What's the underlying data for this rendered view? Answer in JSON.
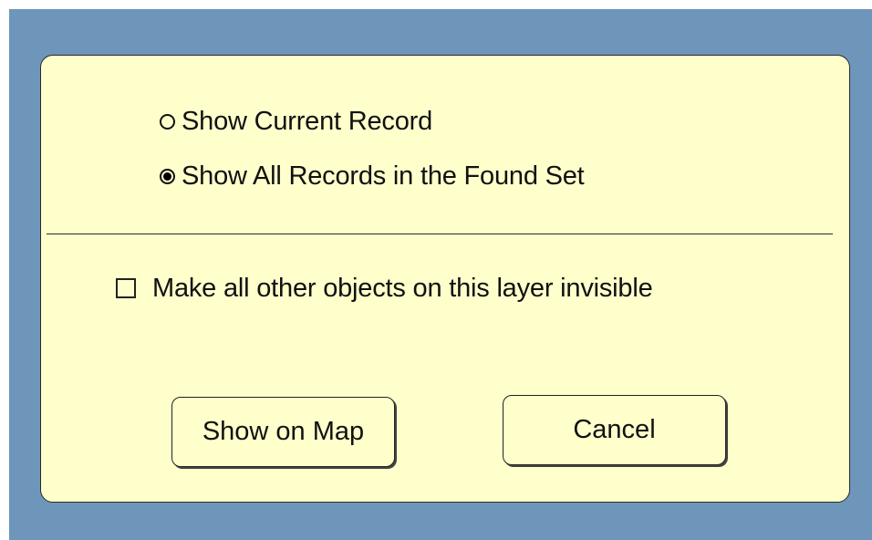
{
  "dialog": {
    "options": [
      {
        "label": "Show Current Record",
        "selected": false
      },
      {
        "label": "Show All Records in the Found Set",
        "selected": true
      }
    ],
    "checkbox": {
      "label": "Make all other objects on this layer invisible",
      "checked": false
    },
    "buttons": {
      "show_on_map": "Show on Map",
      "cancel": "Cancel"
    }
  },
  "colors": {
    "background": "#6e96ba",
    "dialog": "#ffffcc"
  }
}
